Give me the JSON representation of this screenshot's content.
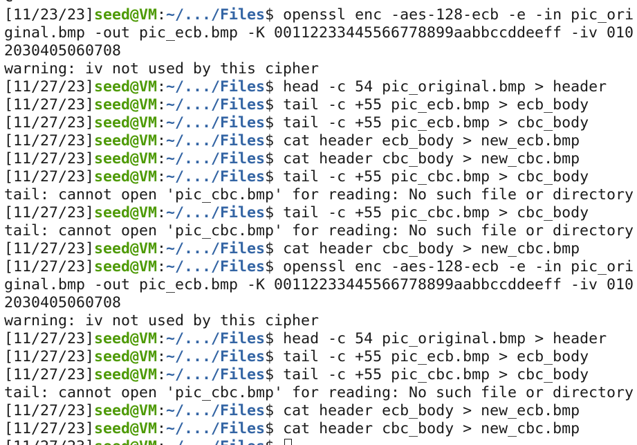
{
  "terminal": {
    "prompt_host": "seed@VM",
    "prompt_path": "~/.../Files",
    "lines": [
      {
        "kind": "out",
        "text": "C"
      },
      {
        "kind": "prompt",
        "ts": "[11/23/23]",
        "cmd": "openssl enc -aes-128-ecb -e -in pic_ori"
      },
      {
        "kind": "out",
        "text": "ginal.bmp -out pic_ecb.bmp -K 00112233445566778899aabbccddeeff -iv 010"
      },
      {
        "kind": "out",
        "text": "2030405060708"
      },
      {
        "kind": "out",
        "text": "warning: iv not used by this cipher"
      },
      {
        "kind": "prompt",
        "ts": "[11/27/23]",
        "cmd": "head -c 54 pic_original.bmp > header"
      },
      {
        "kind": "prompt",
        "ts": "[11/27/23]",
        "cmd": "tail -c +55 pic_ecb.bmp > ecb_body"
      },
      {
        "kind": "prompt",
        "ts": "[11/27/23]",
        "cmd": "tail -c +55 pic_ecb.bmp > cbc_body"
      },
      {
        "kind": "prompt",
        "ts": "[11/27/23]",
        "cmd": "cat header ecb_body > new_ecb.bmp"
      },
      {
        "kind": "prompt",
        "ts": "[11/27/23]",
        "cmd": "cat header cbc_body > new_cbc.bmp"
      },
      {
        "kind": "prompt",
        "ts": "[11/27/23]",
        "cmd": "tail -c +55 pic_cbc.bmp > cbc_body"
      },
      {
        "kind": "out",
        "text": "tail: cannot open 'pic_cbc.bmp' for reading: No such file or directory"
      },
      {
        "kind": "prompt",
        "ts": "[11/27/23]",
        "cmd": "tail -c +55 pic_cbc.bmp > cbc_body"
      },
      {
        "kind": "out",
        "text": "tail: cannot open 'pic_cbc.bmp' for reading: No such file or directory"
      },
      {
        "kind": "prompt",
        "ts": "[11/27/23]",
        "cmd": "cat header cbc_body > new_cbc.bmp"
      },
      {
        "kind": "prompt",
        "ts": "[11/27/23]",
        "cmd": "openssl enc -aes-128-ecb -e -in pic_ori"
      },
      {
        "kind": "out",
        "text": "ginal.bmp -out pic_ecb.bmp -K 00112233445566778899aabbccddeeff -iv 010"
      },
      {
        "kind": "out",
        "text": "2030405060708"
      },
      {
        "kind": "out",
        "text": "warning: iv not used by this cipher"
      },
      {
        "kind": "prompt",
        "ts": "[11/27/23]",
        "cmd": "head -c 54 pic_original.bmp > header"
      },
      {
        "kind": "prompt",
        "ts": "[11/27/23]",
        "cmd": "tail -c +55 pic_ecb.bmp > ecb_body"
      },
      {
        "kind": "prompt",
        "ts": "[11/27/23]",
        "cmd": "tail -c +55 pic_cbc.bmp > cbc_body"
      },
      {
        "kind": "out",
        "text": "tail: cannot open 'pic_cbc.bmp' for reading: No such file or directory"
      },
      {
        "kind": "prompt",
        "ts": "[11/27/23]",
        "cmd": "cat header ecb_body > new_ecb.bmp"
      },
      {
        "kind": "prompt",
        "ts": "[11/27/23]",
        "cmd": "cat header cbc_body > new_cbc.bmp"
      },
      {
        "kind": "prompt-active",
        "ts": "[11/27/23]",
        "cmd": ""
      }
    ]
  },
  "colors": {
    "background": "#ffffff",
    "text": "#1a1a1a",
    "user_host": "#4e9a06",
    "path": "#3465a4"
  }
}
